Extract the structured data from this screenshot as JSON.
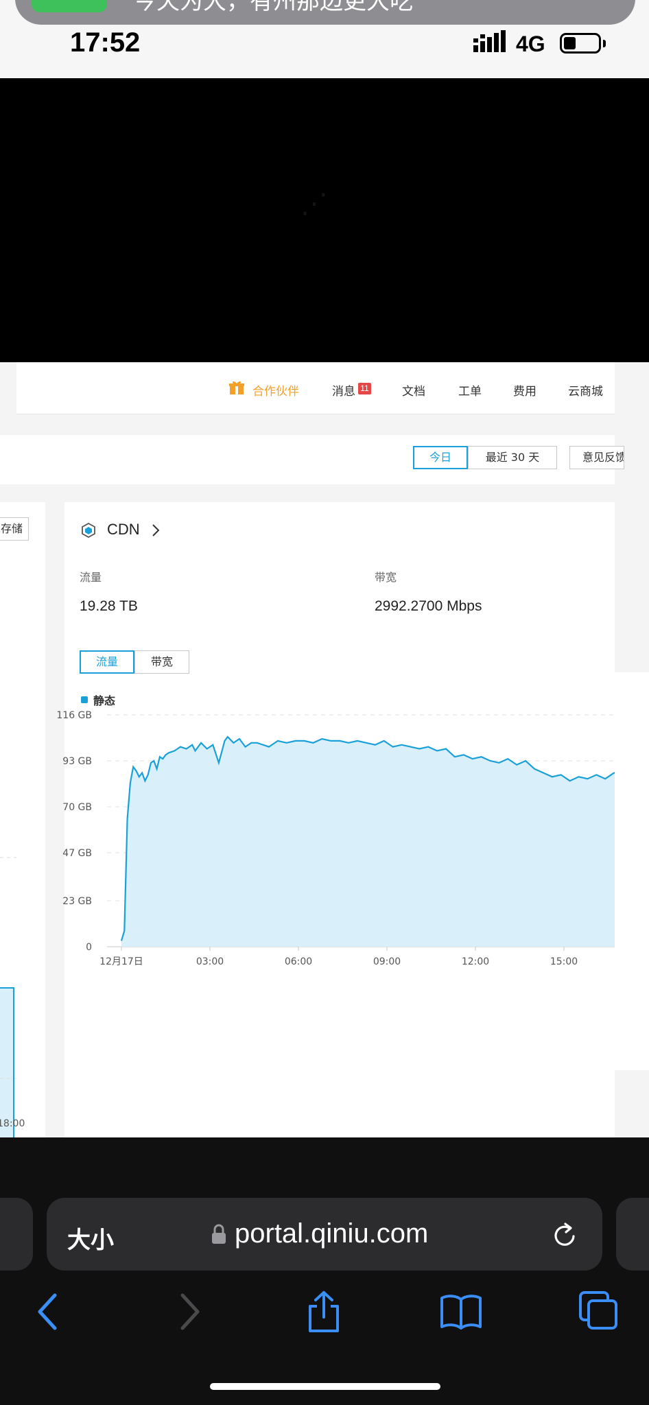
{
  "status": {
    "notification_text": "今天为大，有州那边更大吃",
    "time": "17:52",
    "carrier": "4G"
  },
  "nav": {
    "partner": "合作伙伴",
    "messages": "消息",
    "messages_badge": "11",
    "docs": "文档",
    "ticket": "工单",
    "fees": "费用",
    "store": "云商城"
  },
  "filters": {
    "today": "今日",
    "last30": "最近 30 天",
    "feedback": "意见反馈"
  },
  "left_card": {
    "button": "存储",
    "tick_label": "18:00"
  },
  "cdn": {
    "title": "CDN",
    "flow_label": "流量",
    "flow_value": "19.28 TB",
    "bandwidth_label": "带宽",
    "bandwidth_value": "2992.2700 Mbps",
    "tab_flow": "流量",
    "tab_bandwidth": "带宽",
    "legend": "静态"
  },
  "chart_data": {
    "type": "area",
    "title": "",
    "xlabel": "",
    "ylabel": "",
    "y_ticks": [
      "0",
      "23 GB",
      "47 GB",
      "70 GB",
      "93 GB",
      "116 GB"
    ],
    "x_ticks": [
      "12月17日",
      "03:00",
      "06:00",
      "09:00",
      "12:00",
      "15:00"
    ],
    "ylim_gb": [
      0,
      116
    ],
    "xlim_hours": [
      0,
      17.7
    ],
    "color": "#1aa0d8",
    "fill": "#d9f0fb",
    "series": [
      {
        "name": "静态",
        "x_hours": [
          0.0,
          0.1,
          0.2,
          0.3,
          0.4,
          0.5,
          0.6,
          0.7,
          0.8,
          0.9,
          1.0,
          1.1,
          1.2,
          1.3,
          1.4,
          1.5,
          1.6,
          1.8,
          2.0,
          2.2,
          2.4,
          2.5,
          2.7,
          2.9,
          3.1,
          3.3,
          3.5,
          3.6,
          3.8,
          4.0,
          4.2,
          4.4,
          4.6,
          4.8,
          5.0,
          5.3,
          5.6,
          5.9,
          6.2,
          6.5,
          6.8,
          7.1,
          7.4,
          7.7,
          8.0,
          8.3,
          8.6,
          8.9,
          9.2,
          9.5,
          9.8,
          10.1,
          10.4,
          10.7,
          11.0,
          11.3,
          11.6,
          11.9,
          12.2,
          12.5,
          12.8,
          13.1,
          13.4,
          13.7,
          14.0,
          14.3,
          14.6,
          14.9,
          15.2,
          15.5,
          15.8,
          16.1,
          16.4,
          16.7,
          17.0,
          17.2,
          17.4,
          17.6,
          17.7
        ],
        "y_gb": [
          3,
          8,
          64,
          82,
          90,
          88,
          85,
          87,
          83,
          86,
          92,
          93,
          89,
          95,
          94,
          96,
          97,
          98,
          100,
          99,
          101,
          98,
          102,
          99,
          101,
          92,
          103,
          105,
          102,
          104,
          100,
          102,
          102,
          101,
          100,
          103,
          102,
          103,
          103,
          102,
          104,
          103,
          103,
          102,
          103,
          102,
          101,
          103,
          100,
          101,
          100,
          99,
          100,
          98,
          99,
          95,
          96,
          94,
          95,
          93,
          92,
          94,
          91,
          93,
          89,
          87,
          85,
          86,
          83,
          85,
          84,
          86,
          84,
          87,
          86,
          88,
          85,
          80,
          82
        ]
      }
    ],
    "partial_left_chart_line_gb": 70
  },
  "browser": {
    "text_size": "大小",
    "url": "portal.qiniu.com"
  }
}
